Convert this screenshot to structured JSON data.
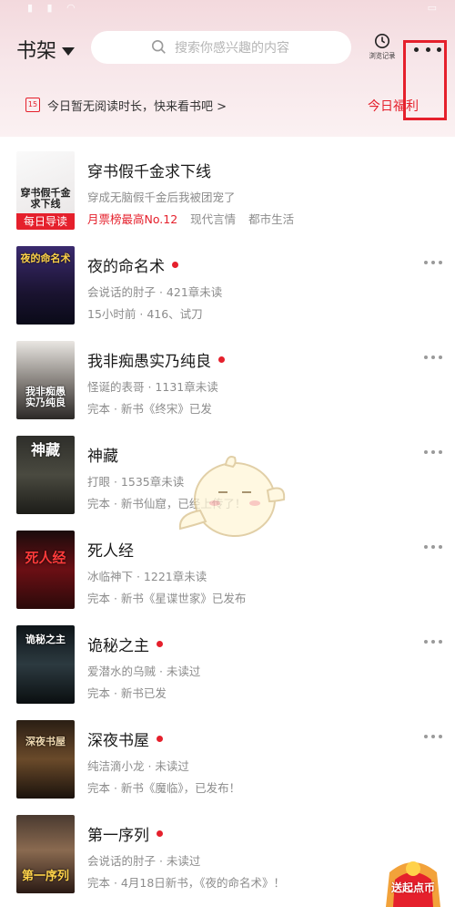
{
  "header": {
    "shelf_title": "书架",
    "search_placeholder": "搜索你感兴趣的内容",
    "history_label": "浏览记录"
  },
  "notice": {
    "calendar_day": "15",
    "message": "今日暂无阅读时长，快来看书吧 >",
    "welfare": "今日福利"
  },
  "books": [
    {
      "title": "穿书假千金求下线",
      "line2": "穿成无脑假千金后我被团宠了",
      "rank": "月票榜最高No.12",
      "tags": [
        "现代言情",
        "都市生活"
      ],
      "cover_text": "穿书假千金求下线",
      "badge": "每日导读"
    },
    {
      "title": "夜的命名术",
      "line2": "会说话的肘子 · 421章未读",
      "line3": "15小时前 · 416、试刀",
      "cover_text": "夜的命名术",
      "updated": true
    },
    {
      "title": "我非痴愚实乃纯良",
      "line2": "怪诞的表哥 · 1131章未读",
      "line3": "完本 · 新书《终宋》已发",
      "cover_text": "我非痴愚 实乃纯良",
      "updated": true
    },
    {
      "title": "神藏",
      "line2": "打眼 · 1535章未读",
      "line3": "完本 · 新书仙窟，已经上传了！",
      "cover_text": "神藏",
      "updated": false
    },
    {
      "title": "死人经",
      "line2": "冰临神下 · 1221章未读",
      "line3": "完本 · 新书《星谍世家》已发布",
      "cover_text": "死人经",
      "updated": false
    },
    {
      "title": "诡秘之主",
      "line2": "爱潜水的乌贼 · 未读过",
      "line3": "完本 · 新书已发",
      "cover_text": "诡秘之主",
      "updated": true
    },
    {
      "title": "深夜书屋",
      "line2": "纯洁滴小龙 · 未读过",
      "line3": "完本 · 新书《魔临》，已发布！",
      "cover_text": "深夜书屋",
      "updated": true
    },
    {
      "title": "第一序列",
      "line2": "会说话的肘子 · 未读过",
      "line3": "完本 · 4月18日新书，《夜的命名术》！",
      "cover_text": "第一序列",
      "updated": true
    }
  ],
  "float_badge": {
    "text": "送起点币"
  },
  "colors": {
    "accent": "#e5202c",
    "muted": "#8c8c8c",
    "top_bg": "#f3d9dd"
  }
}
